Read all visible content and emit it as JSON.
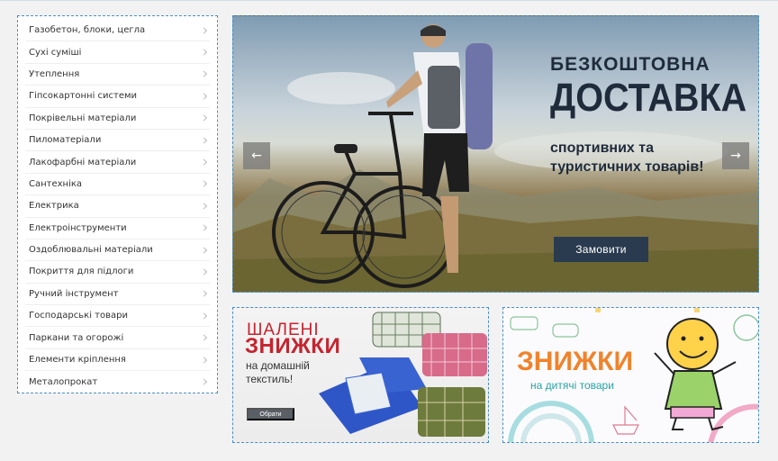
{
  "categories": [
    {
      "label": "Газобетон,  блоки, цегла"
    },
    {
      "label": "Сухі суміші"
    },
    {
      "label": "Утеплення"
    },
    {
      "label": "Гіпсокартонні системи"
    },
    {
      "label": "Покрівельні матеріали"
    },
    {
      "label": "Пиломатеріали"
    },
    {
      "label": "Лакофарбні матеріали"
    },
    {
      "label": "Сантехніка"
    },
    {
      "label": "Електрика"
    },
    {
      "label": "Електроінструменти"
    },
    {
      "label": "Оздоблювальні матеріали"
    },
    {
      "label": "Покриття для підлоги"
    },
    {
      "label": "Ручний інструмент"
    },
    {
      "label": "Господарські товари"
    },
    {
      "label": "Паркани та огорожі"
    },
    {
      "label": "Елементи кріплення"
    },
    {
      "label": "Металопрокат"
    }
  ],
  "hero": {
    "kicker": "БЕЗКОШТОВНА",
    "title": "ДОСТАВКА",
    "subtitle_line1": "спортивних та",
    "subtitle_line2": "туристичних товарів!",
    "button": "Замовити",
    "prev_arrow": "←",
    "next_arrow": "→"
  },
  "promo_textile": {
    "kicker": "ШАЛЕНІ",
    "title": "ЗНИЖКИ",
    "subtitle_line1": "на домашній",
    "subtitle_line2": "текстиль!",
    "button": "Обрати"
  },
  "promo_kids": {
    "title": "ЗНИЖКИ",
    "subtitle": "на дитячі товари"
  },
  "colors": {
    "accent_border": "#4a90c2",
    "hero_text": "#1f2b3a",
    "hero_button": "#2a3b4f",
    "promo_red": "#c4242f",
    "promo_orange": "#f0832b",
    "promo_teal": "#27a3a4"
  }
}
